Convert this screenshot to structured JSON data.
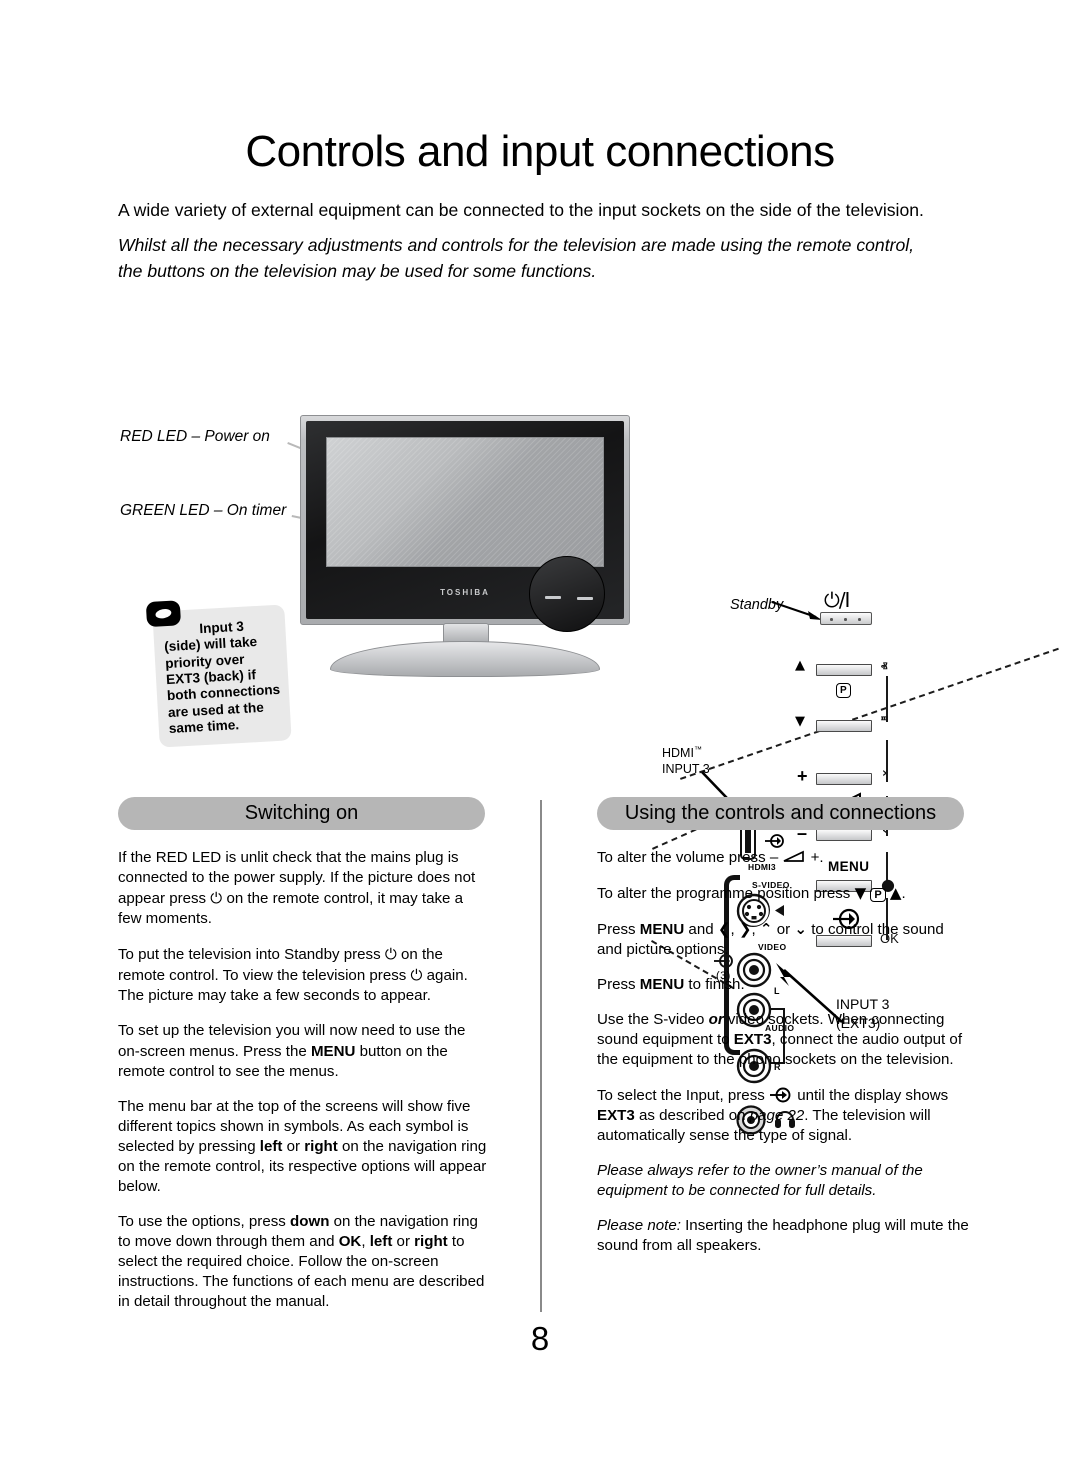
{
  "title": "Controls and input connections",
  "intro": {
    "para1": "A wide variety of external equipment can be connected to the input sockets on the side of the television.",
    "para2": "Whilst all the necessary adjustments and controls for the television are made using the remote control, the buttons on the television may be used for some functions."
  },
  "diagram": {
    "led_red_label": "RED LED – Power on",
    "led_green_label": "GREEN LED – On timer",
    "tv_brand": "TOSHIBA",
    "note": {
      "icon": "note-pointer-icon",
      "line1": "Input 3",
      "line2": "(side) will take",
      "line3": "priority over",
      "line4": "EXT3 (back) if",
      "line5": "both connections",
      "line6": "are used at the",
      "line7": "same time."
    },
    "panel": {
      "standby_label": "Standby",
      "power_symbol": "⏻/I",
      "programme_symbol": "P",
      "plus": "+",
      "minus": "–",
      "up_triangle": "▲",
      "down_triangle": "▼",
      "volume_symbol": "◢",
      "menu_label": "MENU",
      "ok_label": "OK",
      "nav_up": "ⱏ",
      "nav_down": "ⱎ",
      "nav_right": "›",
      "nav_left": "‹",
      "nav_dot": "●",
      "hdmi_label_line1": "HDMI",
      "hdmi_label_tm": "™",
      "hdmi_label_line2": "INPUT 3",
      "hdmi_logo": "HDMI",
      "hdmi3_label": "HDMI3",
      "svideo_label": "S-VIDEO",
      "video_label": "VIDEO",
      "audio_label": "AUDIO",
      "audio_l": "L",
      "audio_r": "R",
      "input_three": "(3)",
      "input3_line1": "INPUT 3",
      "input3_line2": "(EXT3)",
      "headphone_icon": "headphone-icon"
    }
  },
  "sections": {
    "left_heading": "Switching on",
    "right_heading": "Using the controls and connections"
  },
  "left_column": {
    "p1_a": "If the RED LED is unlit check that the mains plug is connected to the power supply. If the picture does not appear press ",
    "p1_b": " on the remote control, it may take a few moments.",
    "p2_a": "To put the television into Standby press ",
    "p2_b": " on the remote control. To view the television press ",
    "p2_c": " again. The picture may take a few seconds to appear.",
    "p3_a": "To set up the television you will now need to use the on-screen menus. Press the ",
    "p3_menu": "MENU",
    "p3_b": " button on the remote control to see the menus.",
    "p4_a": "The menu bar at the top of the screens will show five different topics shown in symbols. As each symbol is selected by pressing ",
    "p4_left": "left",
    "p4_or": " or ",
    "p4_right": "right",
    "p4_b": " on the navigation ring on the remote control, its respective options will appear below.",
    "p5_a": "To use the options, press ",
    "p5_down": "down",
    "p5_b": " on the navigation ring to move down through them and ",
    "p5_ok": "OK",
    "p5_comma": ", ",
    "p5_left": "left",
    "p5_or": " or ",
    "p5_right": "right",
    "p5_c": " to select the required choice. Follow the on-screen instructions. The functions of each menu are described in detail throughout the manual."
  },
  "right_column": {
    "p1_a": "To alter the volume press – ",
    "p1_b": " +.",
    "p2_a": "To alter the programme position press ",
    "p3_a": "Press ",
    "p3_menu": "MENU",
    "p3_b": " and ",
    "p3_c": " to control the sound and picture options.",
    "p3_or": " or ",
    "p4_a": "Press ",
    "p4_menu": "MENU",
    "p4_b": " to finish.",
    "p5_a": "Use the S-video ",
    "p5_or": "or",
    "p5_b": " video sockets. When connecting sound equipment to ",
    "p5_ext3": "EXT3",
    "p5_c": ", connect the audio output of the equipment to the phono sockets on the television.",
    "p6_a": "To select the Input, press ",
    "p6_b": " until the display shows ",
    "p6_ext3": "EXT3",
    "p6_c": " as described on ",
    "p6_page": "page 22",
    "p6_d": ". The television will automatically sense the type of signal.",
    "p7": "Please always refer to the owner’s manual of the equipment to be connected for full details.",
    "p8_a": "Please note:",
    "p8_b": " Inserting the headphone plug will mute the sound from all speakers."
  },
  "footer": {
    "page_number": "8"
  }
}
